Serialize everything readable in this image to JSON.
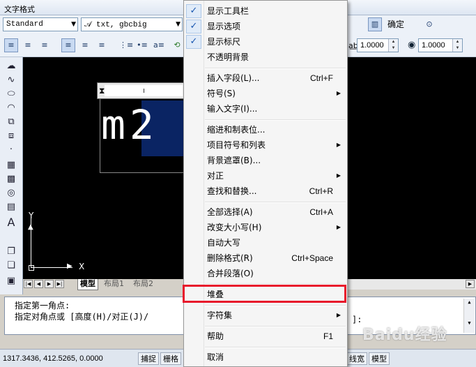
{
  "toolbar": {
    "title": "文字格式",
    "style": "Standard",
    "font": "txt, gbcbig",
    "ok": "确定",
    "tracking": "1.0000",
    "width_factor": "1.0000"
  },
  "canvas": {
    "sample_text": "m2",
    "ucs_x": "X",
    "ucs_y": "Y"
  },
  "tabs": [
    "模型",
    "布局1",
    "布局2"
  ],
  "command": {
    "line1": "指定第一角点:",
    "line2": "指定对角点或 [高度(H)/对正(J)/",
    "line2_end": "]:"
  },
  "status": {
    "coords": "1317.3436, 412.5265, 0.0000",
    "snap": "捕捉",
    "grid": "栅格",
    "lineweight": "线宽",
    "model": "模型"
  },
  "menu": {
    "show_toolbar": "显示工具栏",
    "show_options": "显示选项",
    "show_ruler": "显示标尺",
    "opaque_bg": "不透明背景",
    "insert_field": "插入字段(L)...",
    "insert_field_sc": "Ctrl+F",
    "symbol": "符号(S)",
    "input_text": "输入文字(I)...",
    "indent_tabs": "缩进和制表位...",
    "bullets": "项目符号和列表",
    "bg_mask": "背景遮罩(B)...",
    "justify": "对正",
    "find_replace": "查找和替换...",
    "find_replace_sc": "Ctrl+R",
    "select_all": "全部选择(A)",
    "select_all_sc": "Ctrl+A",
    "change_case": "改变大小写(H)",
    "autocaps": "自动大写",
    "remove_format": "删除格式(R)",
    "remove_format_sc": "Ctrl+Space",
    "combine_para": "合并段落(O)",
    "stack": "堆叠",
    "charset": "字符集",
    "help": "帮助",
    "help_sc": "F1",
    "cancel": "取消"
  },
  "watermark": "Baidu经验",
  "colors": {
    "highlight": "#e8172b",
    "selection": "#0a2463",
    "check": "#1a57b0"
  }
}
